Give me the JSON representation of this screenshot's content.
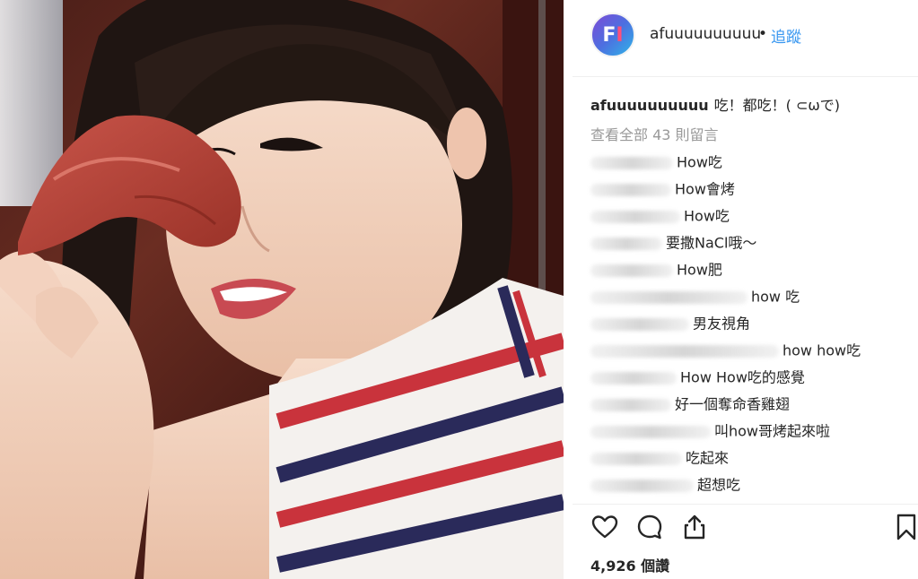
{
  "post": {
    "username": "afuuuuuuuuuu",
    "separator": "•",
    "follow_label": "追蹤",
    "caption_user": "afuuuuuuuuuu",
    "caption_text": "吃！都吃！( ⊂ωで)",
    "view_all_label": "查看全部 43 則留言",
    "likes_label": "4,926 個讚"
  },
  "comments": [
    {
      "text": "How吃"
    },
    {
      "text": "How會烤"
    },
    {
      "text": "How吃"
    },
    {
      "text": "要撒NaCl哦～"
    },
    {
      "text": "How肥"
    },
    {
      "text": "how 吃"
    },
    {
      "text": "男友視角"
    },
    {
      "text": "how how吃"
    },
    {
      "text": "How How吃的感覺"
    },
    {
      "text": "好一個奪命香雞翅"
    },
    {
      "text": "叫how哥烤起來啦"
    },
    {
      "text": "吃起來"
    },
    {
      "text": "超想吃"
    }
  ],
  "colors": {
    "link_blue": "#3897f0",
    "text": "#262626",
    "muted": "#999999",
    "divider": "#efefef"
  },
  "icons": [
    "heart-icon",
    "comment-icon",
    "share-icon",
    "bookmark-icon"
  ]
}
